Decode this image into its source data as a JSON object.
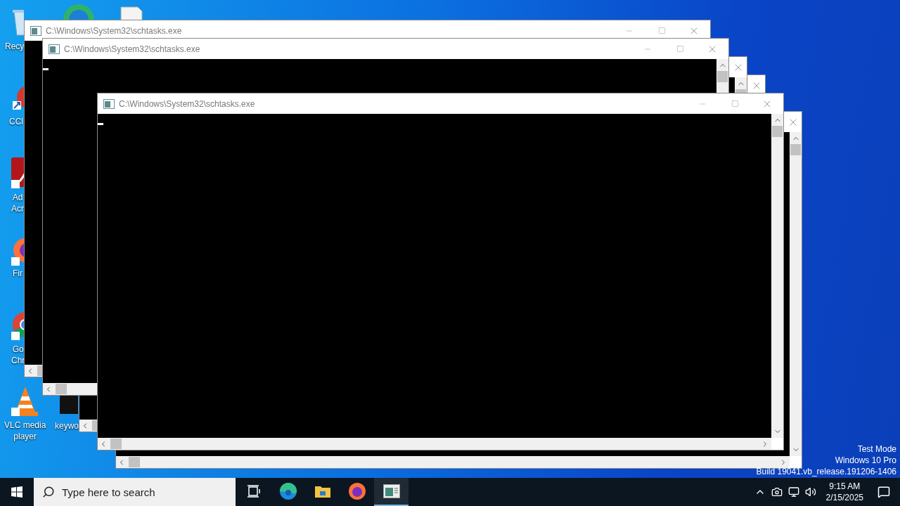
{
  "desktop_icons": [
    {
      "kind": "recycle",
      "label": "Recy"
    },
    {
      "kind": "browser"
    },
    {
      "kind": "document"
    },
    {
      "kind": "cleaner",
      "label": "CCl"
    },
    {
      "kind": "acrobat",
      "label": "Ad\nAcr"
    },
    {
      "kind": "firefox",
      "label": "Fir"
    },
    {
      "kind": "chrome",
      "label": "Go\nChr"
    },
    {
      "kind": "vlc",
      "label": "VLC media\nplayer"
    },
    {
      "kind": "file",
      "label": "keywo"
    }
  ],
  "windows": [
    {
      "kind": "console",
      "title": "C:\\Windows\\System32\\schtasks.exe"
    },
    {
      "kind": "console",
      "title": "C:\\Windows\\System32\\schtasks.exe",
      "cursor": true
    },
    {
      "kind": "console"
    },
    {
      "kind": "console"
    },
    {
      "kind": "console",
      "title": "C:\\Windows\\System32\\schtasks.exe",
      "cursor": true
    },
    {
      "kind": "console"
    }
  ],
  "watermark": [
    "Test Mode",
    "Windows 10 Pro",
    "Build 19041.vb_release.191206-1406"
  ],
  "taskbar": {
    "search": {
      "placeholder": "Type here to search"
    },
    "apps": [
      {
        "kind": "taskview",
        "selected": false
      },
      {
        "kind": "edge",
        "selected": false
      },
      {
        "kind": "explorer",
        "selected": false
      },
      {
        "kind": "firefox",
        "selected": false
      },
      {
        "kind": "console",
        "selected": true
      }
    ],
    "clock": {
      "time": "9:15 AM",
      "date": "2/15/2025"
    }
  }
}
